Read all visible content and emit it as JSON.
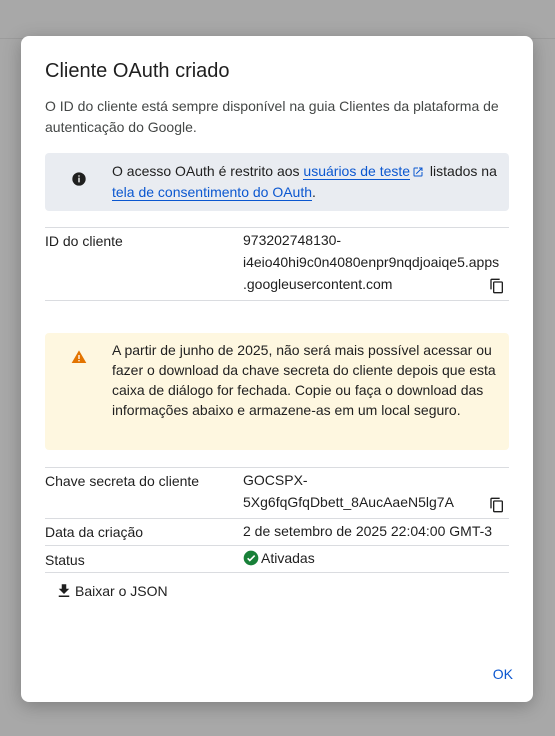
{
  "dialog": {
    "title": "Cliente OAuth criado",
    "description": "O ID do cliente está sempre disponível na guia Clientes da plataforma de autenticação do Google.",
    "info": {
      "prefix": "O acesso OAuth é restrito aos ",
      "link1": "usuários de teste",
      "middle": " listados na ",
      "link2": "tela de consentimento do OAuth",
      "suffix": "."
    },
    "client_id": {
      "label": "ID do cliente",
      "line1": "973202748130-",
      "line2": "i4eio40hi9c0n4080enpr9nqdjoaiqe5.apps",
      "line3": ".googleusercontent.com"
    },
    "warning": "A partir de junho de 2025, não será mais possível acessar ou fazer o download da chave secreta do cliente depois que esta caixa de diálogo for fechada. Copie ou faça o download das informações abaixo e armazene-as em um local seguro.",
    "secret": {
      "label": "Chave secreta do cliente",
      "line1": "GOCSPX-",
      "line2": "5Xg6fqGfqDbett_8AucAaeN5lg7A"
    },
    "created": {
      "label": "Data da criação",
      "value": "2 de setembro de 2025 22:04:00 GMT-3"
    },
    "status": {
      "label": "Status",
      "value": "Ativadas"
    },
    "download_label": "Baixar o JSON",
    "ok_label": "OK"
  },
  "colors": {
    "link": "#0b57d0",
    "info_bg": "#e9ecf1",
    "warning_bg": "#fef7e0",
    "warning_icon": "#e37400",
    "status_green": "#188038"
  },
  "icons": [
    "info-icon",
    "external-link-icon",
    "copy-icon",
    "warning-icon",
    "check-circle-icon",
    "download-icon"
  ]
}
